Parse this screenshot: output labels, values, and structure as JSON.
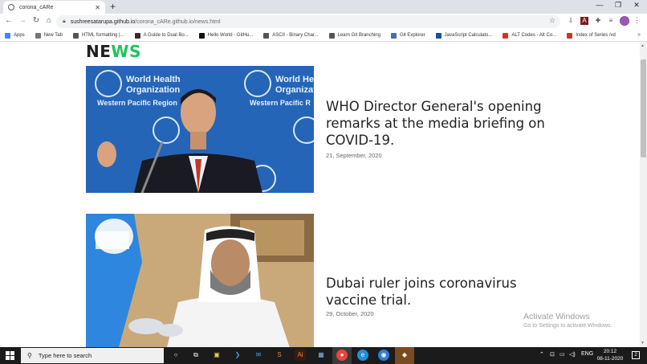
{
  "browser": {
    "tab_title": "corona_cARe",
    "tab_close": "✕",
    "new_tab": "+",
    "url_host": "sushreesatarupa.github.io",
    "url_path": "/corona_cARe.github.io/news.html",
    "minimize": "—",
    "maximize": "❐",
    "close": "✕"
  },
  "bookmarks": [
    {
      "label": "Apps",
      "color": "#4285f4"
    },
    {
      "label": "New Tab",
      "color": "#777777"
    },
    {
      "label": "HTML formatting |...",
      "color": "#555555"
    },
    {
      "label": "A Guide to Dual Bo...",
      "color": "#3b2a2a"
    },
    {
      "label": "Hello World - GitHu...",
      "color": "#111111"
    },
    {
      "label": "ASCII - Binary Char...",
      "color": "#555555"
    },
    {
      "label": "Learn Git Branching",
      "color": "#555555"
    },
    {
      "label": "Git Explorer",
      "color": "#4a6fa5"
    },
    {
      "label": "JavaScript Calculato...",
      "color": "#1a4fa0"
    },
    {
      "label": "ALT Codes - Alt Co...",
      "color": "#d93025"
    },
    {
      "label": "Index of Series /vd",
      "color": "#c0392b"
    }
  ],
  "page": {
    "heading_part1": "NE",
    "heading_part2": "WS",
    "articles": [
      {
        "title": "WHO Director General's opening remarks at the media briefing on COVID-19.",
        "date": "21, September, 2020"
      },
      {
        "title": "Dubai ruler joins coronavirus vaccine trial.",
        "date": "29, October, 2020"
      }
    ],
    "watermark_title": "Activate Windows",
    "watermark_sub": "Go to Settings to activate Windows."
  },
  "taskbar": {
    "search_placeholder": "Type here to search",
    "lang": "ENG",
    "time": "20:12",
    "date": "08-11-2020"
  },
  "colors": {
    "accent_green": "#20c35a",
    "who_blue": "#1f5fb0"
  }
}
